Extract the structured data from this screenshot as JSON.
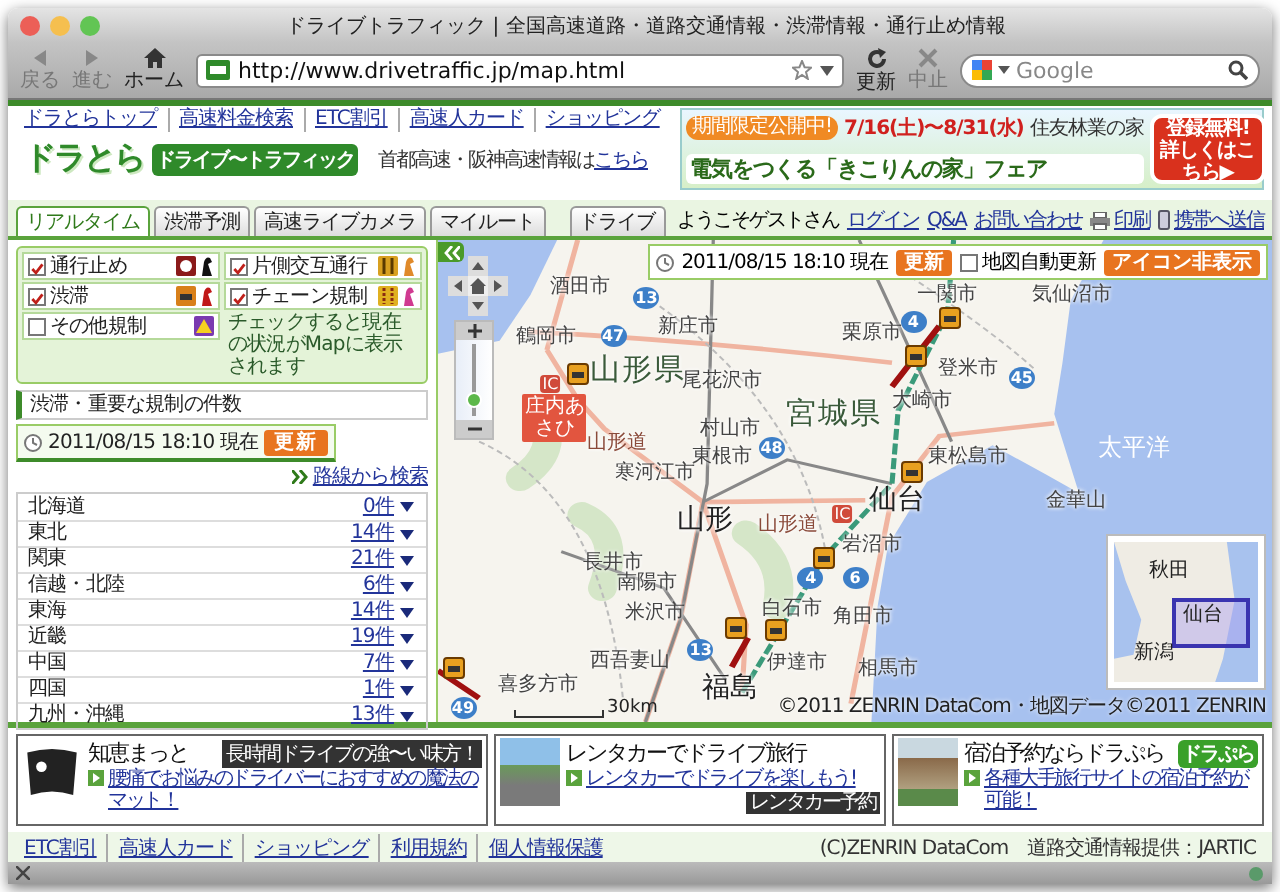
{
  "window": {
    "title": "ドライブトラフィック | 全国高速道路・道路交通情報・渋滞情報・通行止め情報"
  },
  "toolbar": {
    "nav": [
      {
        "label": "戻る",
        "kind": "back",
        "disabled": true
      },
      {
        "label": "進む",
        "kind": "forward",
        "disabled": true
      },
      {
        "label": "ホーム",
        "kind": "home",
        "disabled": false
      }
    ],
    "address": "http://www.drivetraffic.jp/map.html",
    "actions": [
      {
        "label": "更新",
        "kind": "reload",
        "disabled": false
      },
      {
        "label": "中止",
        "kind": "stop",
        "disabled": true
      }
    ],
    "search": {
      "placeholder": "Google"
    }
  },
  "top_links": [
    "ドラとらトップ",
    "高速料金検索",
    "ETC割引",
    "高速人カード",
    "ショッピング"
  ],
  "logo": {
    "name": "ドラとら",
    "tagline": "ドライブ〜トラフィック"
  },
  "header_note": {
    "text": "首都高速・阪神高速情報は",
    "link": "こちら"
  },
  "banner": {
    "badge": "期間限定公開中!",
    "dates": "7/16(土)〜8/31(水)",
    "sponsor": "住友林業の家",
    "headline": "電気をつくる「きこりんの家」フェア",
    "cta": [
      "登録無料!",
      "詳しくはこちら▶"
    ]
  },
  "tabs": [
    {
      "label": "リアルタイム",
      "selected": true
    },
    {
      "label": "渋滞予測",
      "selected": false
    },
    {
      "label": "高速ライブカメラ",
      "selected": false
    },
    {
      "label": "マイルート",
      "selected": false
    }
  ],
  "drive_button": "ドライブ",
  "welcome": "ようこそゲストさん",
  "user_links": [
    {
      "label": "ログイン",
      "kind": "link"
    },
    {
      "label": "Q&A",
      "kind": "link"
    },
    {
      "label": "お問い合わせ",
      "kind": "link"
    },
    {
      "label": "印刷",
      "kind": "print"
    },
    {
      "label": "携帯へ送信",
      "kind": "mobile"
    }
  ],
  "filters": [
    {
      "label": "通行止め",
      "checked": true,
      "kind": "closure"
    },
    {
      "label": "片側交互通行",
      "checked": true,
      "kind": "alternating"
    },
    {
      "label": "渋滞",
      "checked": true,
      "kind": "jam"
    },
    {
      "label": "チェーン規制",
      "checked": true,
      "kind": "chain"
    },
    {
      "label": "その他規制",
      "checked": false,
      "kind": "other"
    }
  ],
  "filter_note": "チェックすると現在の状況がMapに表示されます",
  "counts": {
    "heading": "渋滞・重要な規制の件数",
    "timestamp": "2011/08/15 18:10 現在",
    "refresh": "更新",
    "route_search": "路線から検索",
    "regions": [
      {
        "name": "北海道",
        "count": "0件"
      },
      {
        "name": "東北",
        "count": "14件"
      },
      {
        "name": "関東",
        "count": "21件"
      },
      {
        "name": "信越・北陸",
        "count": "6件"
      },
      {
        "name": "東海",
        "count": "14件"
      },
      {
        "name": "近畿",
        "count": "19件"
      },
      {
        "name": "中国",
        "count": "7件"
      },
      {
        "name": "四国",
        "count": "1件"
      },
      {
        "name": "九州・沖縄",
        "count": "13件"
      }
    ]
  },
  "map": {
    "status": {
      "timestamp": "2011/08/15 18:10 現在",
      "refresh": "更新",
      "auto_refresh": {
        "label": "地図自動更新",
        "checked": false
      },
      "hide_icons": "アイコン非表示"
    },
    "zoom": {
      "level": 0.22
    },
    "labels": [
      {
        "text": "山形県",
        "kind": "prefecture"
      },
      {
        "text": "宮城県",
        "kind": "prefecture"
      },
      {
        "text": "山形",
        "kind": "major"
      },
      {
        "text": "仙台",
        "kind": "major"
      },
      {
        "text": "福島",
        "kind": "major"
      },
      {
        "text": "太平洋",
        "kind": "sea"
      },
      {
        "text": "酒田市",
        "kind": "city"
      },
      {
        "text": "鶴岡市",
        "kind": "city"
      },
      {
        "text": "新庄市",
        "kind": "city"
      },
      {
        "text": "尾花沢市",
        "kind": "city"
      },
      {
        "text": "村山市",
        "kind": "city"
      },
      {
        "text": "東根市",
        "kind": "city"
      },
      {
        "text": "寒河江市",
        "kind": "city"
      },
      {
        "text": "山形道",
        "kind": "road"
      },
      {
        "text": "山形道",
        "kind": "road"
      },
      {
        "text": "一関市",
        "kind": "city"
      },
      {
        "text": "気仙沼市",
        "kind": "city"
      },
      {
        "text": "栗原市",
        "kind": "city"
      },
      {
        "text": "登米市",
        "kind": "city"
      },
      {
        "text": "大崎市",
        "kind": "city"
      },
      {
        "text": "東松島市",
        "kind": "city"
      },
      {
        "text": "金華山",
        "kind": "city"
      },
      {
        "text": "岩沼市",
        "kind": "city"
      },
      {
        "text": "長井市",
        "kind": "city"
      },
      {
        "text": "南陽市",
        "kind": "city"
      },
      {
        "text": "米沢市",
        "kind": "city"
      },
      {
        "text": "白石市",
        "kind": "city"
      },
      {
        "text": "角田市",
        "kind": "city"
      },
      {
        "text": "西吾妻山",
        "kind": "city"
      },
      {
        "text": "伊達市",
        "kind": "city"
      },
      {
        "text": "相馬市",
        "kind": "city"
      },
      {
        "text": "喜多方市",
        "kind": "city"
      },
      {
        "text": "IC",
        "kind": "ic"
      },
      {
        "text": "IC",
        "kind": "ic"
      }
    ],
    "route_markers": [
      "13",
      "47",
      "4",
      "45",
      "48",
      "4",
      "6",
      "13",
      "49"
    ],
    "place_marker": "庄内あさひ",
    "scale": "30km",
    "copyright": "©2011 ZENRIN DataCom・地図データ©2011 ZENRIN",
    "overview": [
      "秋田",
      "仙台",
      "新潟"
    ]
  },
  "ads": [
    {
      "title": "知恵まっと",
      "tag": "長時間ドライブの強〜い味方！",
      "link": "腰痛でお悩みのドライバーにおすすめの魔法のマット！",
      "kind": "mat"
    },
    {
      "title": "レンタカーでドライブ旅行",
      "tag": "レンタカー予約",
      "link": "レンタカーでドライブを楽しもう!",
      "kind": "rental"
    },
    {
      "title": "宿泊予約ならドラぷら",
      "tag": "ドラぷら",
      "link": "各種大手旅行サイトの宿泊予約が可能！",
      "kind": "hotel"
    }
  ],
  "footer": {
    "links": [
      "ETC割引",
      "高速人カード",
      "ショッピング",
      "利用規約",
      "個人情報保護"
    ],
    "credit": "(C)ZENRIN DataCom　道路交通情報提供：JARTIC"
  }
}
